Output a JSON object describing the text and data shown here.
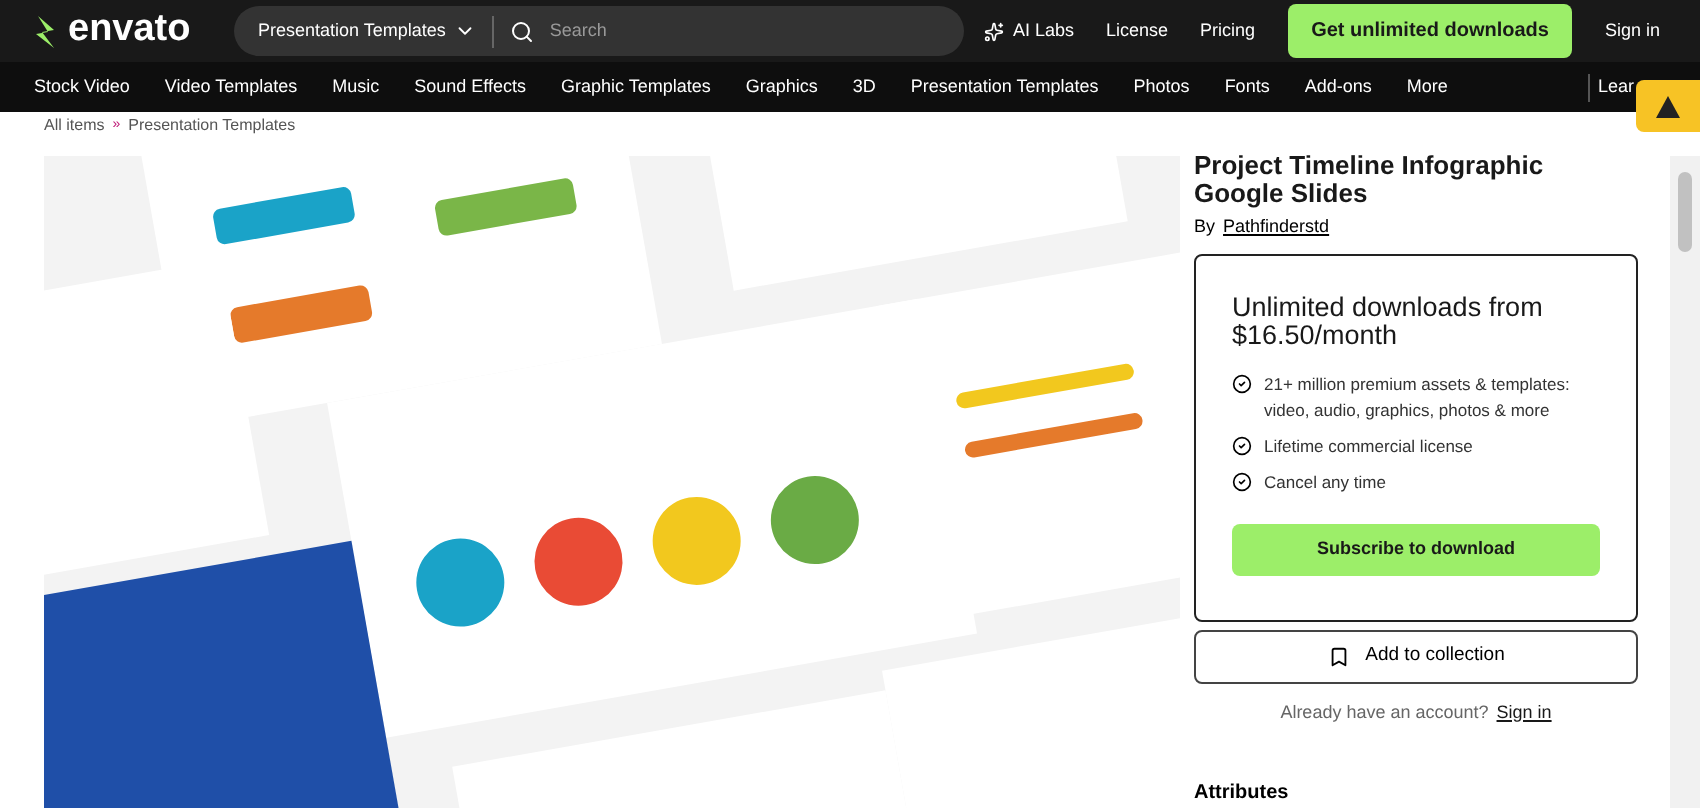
{
  "header": {
    "logo": "envato",
    "category_select": "Presentation Templates",
    "search": {
      "placeholder": "Search"
    },
    "links": [
      {
        "label": "AI Labs",
        "kind": "sparkle"
      },
      {
        "label": "License",
        "kind": "plain"
      },
      {
        "label": "Pricing",
        "kind": "plain"
      }
    ],
    "cta": "Get unlimited downloads",
    "sign_in": "Sign in"
  },
  "nav": {
    "items": [
      "Stock Video",
      "Video Templates",
      "Music",
      "Sound Effects",
      "Graphic Templates",
      "Graphics",
      "3D",
      "Presentation Templates",
      "Photos",
      "Fonts",
      "Add-ons",
      "More"
    ],
    "cut_item": "Lear"
  },
  "breadcrumb": [
    "All items",
    "Presentation Templates"
  ],
  "breadcrumb_separator": "»",
  "preview": {
    "kind": "picture"
  },
  "product": {
    "title": "Project Timeline Infographic Google Slides",
    "by": "By",
    "author": "Pathfinderstd"
  },
  "offer": {
    "heading": "Unlimited downloads from $16.50/month",
    "features": [
      "21+ million premium assets & templates: video, audio, graphics, photos & more",
      "Lifetime commercial license",
      "Cancel any time"
    ],
    "subscribe": "Subscribe to download"
  },
  "collection_button": "Add to collection",
  "account": {
    "question": "Already have an account?",
    "link": "Sign in"
  },
  "attributes_heading": "Attributes"
}
